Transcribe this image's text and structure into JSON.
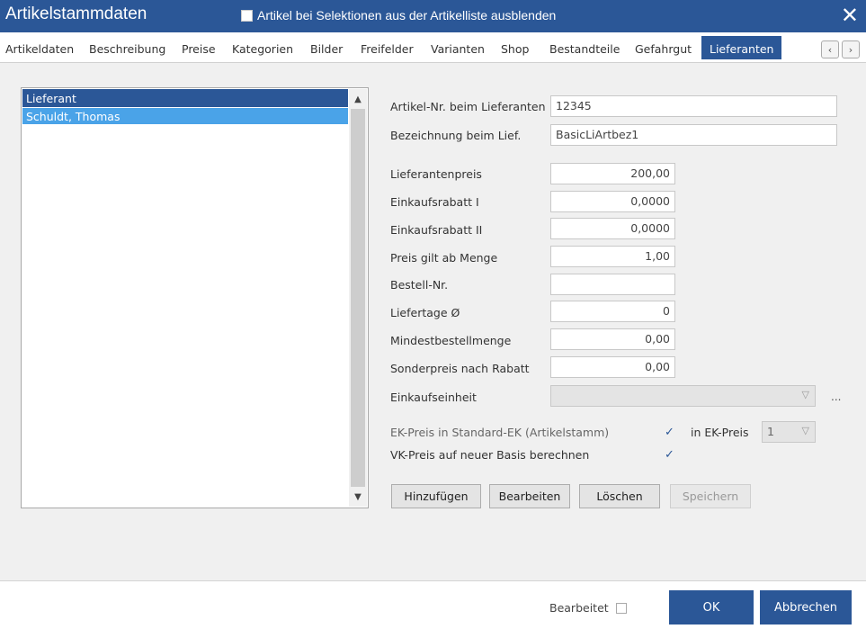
{
  "window": {
    "title": "Artikelstammdaten",
    "hide_checkbox_label": "Artikel bei Selektionen aus der Artikelliste ausblenden",
    "close_glyph": "✕"
  },
  "tabs": [
    {
      "label": "Artikeldaten"
    },
    {
      "label": "Beschreibung"
    },
    {
      "label": "Preise"
    },
    {
      "label": "Kategorien"
    },
    {
      "label": "Bilder"
    },
    {
      "label": "Freifelder"
    },
    {
      "label": "Varianten"
    },
    {
      "label": "Shop"
    },
    {
      "label": "Bestandteile"
    },
    {
      "label": "Gefahrgut"
    },
    {
      "label": "Lieferanten"
    }
  ],
  "nav": {
    "prev_icon": "chevron-left-icon",
    "next_icon": "chevron-right-icon"
  },
  "supplier_list": {
    "header": "Lieferant",
    "rows": [
      "Schuldt, Thomas"
    ]
  },
  "form": {
    "artikel_nr_label": "Artikel-Nr. beim Lieferanten",
    "artikel_nr_value": "12345",
    "bezeichnung_label": "Bezeichnung beim Lief.",
    "bezeichnung_value": "BasicLiArtbez1",
    "lieferantenpreis_label": "Lieferantenpreis",
    "lieferantenpreis_value": "200,00",
    "rabatt1_label": "Einkaufsrabatt I",
    "rabatt1_value": "0,0000",
    "rabatt2_label": "Einkaufsrabatt II",
    "rabatt2_value": "0,0000",
    "menge_label": "Preis gilt ab Menge",
    "menge_value": "1,00",
    "bestell_label": "Bestell-Nr.",
    "bestell_value": "",
    "liefertage_label": "Liefertage Ø",
    "liefertage_value": "0",
    "mindest_label": "Mindestbestellmenge",
    "mindest_value": "0,00",
    "sonderpreis_label": "Sonderpreis nach Rabatt",
    "sonderpreis_value": "0,00",
    "einheit_label": "Einkaufseinheit",
    "einheit_value": "",
    "einheit_more": "...",
    "ek_standard_label": "EK-Preis in Standard-EK (Artikelstamm)",
    "ek_standard_checked": "✓",
    "in_ek_preis_label": "in EK-Preis",
    "in_ek_preis_value": "1",
    "vk_label": "VK-Preis auf neuer Basis berechnen",
    "vk_checked": "✓"
  },
  "buttons": {
    "add": "Hinzufügen",
    "edit": "Bearbeiten",
    "delete": "Löschen",
    "save": "Speichern"
  },
  "footer": {
    "bearbeitet_label": "Bearbeitet",
    "ok": "OK",
    "cancel": "Abbrechen"
  },
  "colors": {
    "accent": "#2b5797",
    "selection": "#4aa3e8"
  }
}
